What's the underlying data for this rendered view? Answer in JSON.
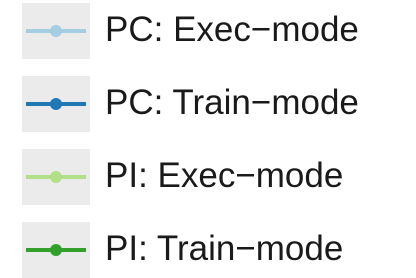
{
  "chart_data": {
    "type": "line",
    "legend": [
      {
        "name": "PC: Exec−mode",
        "color": "#a6cee3"
      },
      {
        "name": "PC: Train−mode",
        "color": "#1f78b4"
      },
      {
        "name": "PI: Exec−mode",
        "color": "#b2df8a"
      },
      {
        "name": "PI: Train−mode",
        "color": "#33a02c"
      }
    ]
  }
}
